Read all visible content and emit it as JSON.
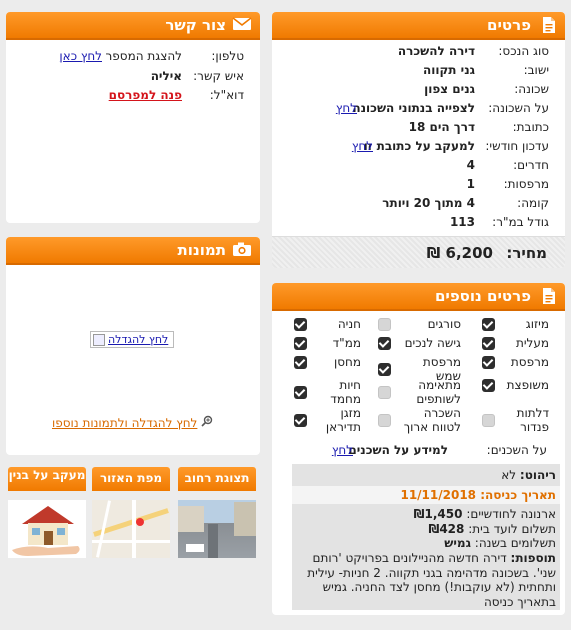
{
  "details": {
    "title": "פרטים",
    "rows": [
      {
        "label": "סוג הנכס:",
        "value": "דירה להשכרה"
      },
      {
        "label": "ישוב:",
        "value": "גני תקווה"
      },
      {
        "label": "שכונה:",
        "value": "גנים צפון"
      },
      {
        "label": "על השכונה:",
        "value": "לצפייה בנתוני השכונה",
        "link": "לחץ"
      },
      {
        "label": "כתובת:",
        "value": "דרך הים 18"
      },
      {
        "label": "עדכון חודשי:",
        "value": "למעקב על כתובת זו",
        "link": "לחץ"
      },
      {
        "label": "חדרים:",
        "value": "4"
      },
      {
        "label": "מרפסות:",
        "value": "1"
      },
      {
        "label": "קומה:",
        "value": "4 מתוך 20 ויותר"
      },
      {
        "label": "גודל במ\"ר:",
        "value": "113"
      }
    ],
    "price_label": "מחיר:",
    "price_value": "6,200 ₪"
  },
  "contact": {
    "title": "צור קשר",
    "phone_label": "טלפון:",
    "phone_text": "להצגת המספר",
    "phone_link": "לחץ כאן",
    "person_label": "איש קשר:",
    "person_value": "איליה",
    "email_label": "דוא\"ל:",
    "email_link": "פנה למפרסם"
  },
  "photos": {
    "title": "תמונות",
    "image_alt": "לחץ להגדלה",
    "more_link": "לחץ להגדלה ולתמונות נוספו"
  },
  "tiles": [
    {
      "label": "תצוגת רחוב"
    },
    {
      "label": "מפת האזור"
    },
    {
      "label": "מעקב על בנין"
    }
  ],
  "extra": {
    "title": "פרטים נוספים",
    "features": [
      {
        "label": "מיזוג",
        "checked": true
      },
      {
        "label": "סורגים",
        "checked": false
      },
      {
        "label": "חניה",
        "checked": true
      },
      {
        "label": "מעלית",
        "checked": true
      },
      {
        "label": "גישה לנכים",
        "checked": true
      },
      {
        "label": "ממ\"ד",
        "checked": true
      },
      {
        "label": "מרפסת",
        "checked": true
      },
      {
        "label": "מרפסת שמש",
        "checked": true
      },
      {
        "label": "מחסן",
        "checked": true
      },
      {
        "label": "משופצת",
        "checked": true
      },
      {
        "label": "מתאימה לשותפים",
        "checked": false
      },
      {
        "label": "חיות מחמד",
        "checked": true
      },
      {
        "label": "דלתות פנדור",
        "checked": false
      },
      {
        "label": "השכרה לטווח ארוך",
        "checked": false
      },
      {
        "label": "מזגן תדיראן",
        "checked": true
      }
    ],
    "neighbors_label": "על השכנים:",
    "neighbors_value": "למידע על השכנים",
    "neighbors_link": "לחץ",
    "info": {
      "furniture_label": "ריהוט:",
      "furniture_value": "לא",
      "entry_label": "תאריך כניסה:",
      "entry_value": "11/11/2018",
      "arnona_label": "ארנונה לחודשיים:",
      "arnona_value": "₪1,450",
      "vaad_label": "תשלום לועד בית:",
      "vaad_value": "₪428",
      "payments_label": "תשלומים בשנה:",
      "payments_value": "גמיש",
      "extra_label": "תוספות:",
      "extra_value": "דירה חדשה מהניילונים בפרויקט 'רותם שני'. בשכונה מדהימה בגני תקווה. 2 חניות- עילית ותחתית (לא עוקבות!) מחסן לצד החניה. גמיש בתאריך כניסה"
    }
  }
}
